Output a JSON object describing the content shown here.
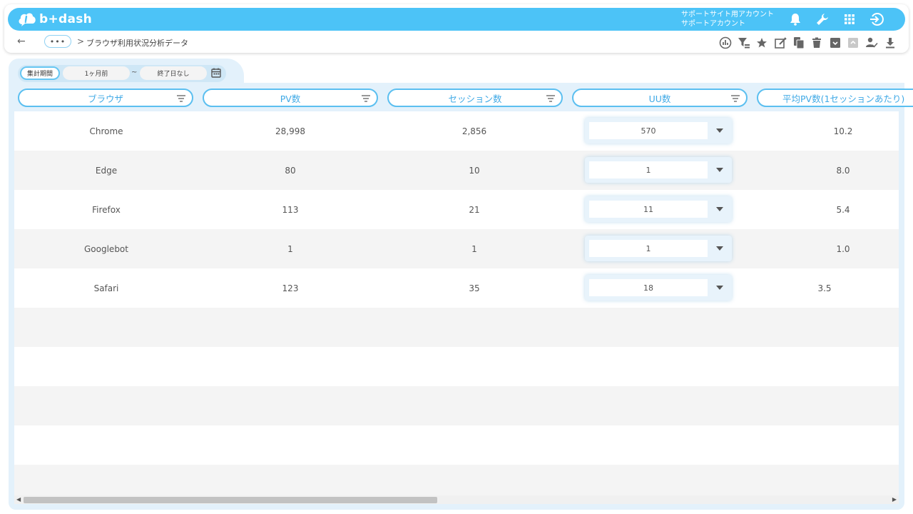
{
  "header": {
    "logo": "b+dash",
    "account_line1": "サポートサイト用アカウント",
    "account_line2": "サポートアカウント",
    "icons": [
      "bell-icon",
      "wrench-icon",
      "apps-grid-icon",
      "logout-icon"
    ]
  },
  "breadcrumb": {
    "back": "←",
    "more": "•••",
    "separator": ">",
    "title": "ブラウザ利用状況分析データ"
  },
  "toolbar": {
    "icons": [
      "chart-icon",
      "filter-icon",
      "star-icon",
      "edit-icon",
      "copy-icon",
      "trash-icon",
      "archive-icon",
      "unarchive-icon",
      "approve-icon",
      "download-icon"
    ]
  },
  "period": {
    "label": "集計期間",
    "start": "1ヶ月前",
    "tilde": "~",
    "end": "終了日なし"
  },
  "table": {
    "columns": [
      "ブラウザ",
      "PV数",
      "セッション数",
      "UU数",
      "平均PV数(1セッションあたり)"
    ],
    "rows": [
      {
        "browser": "Chrome",
        "pv": "28,998",
        "sessions": "2,856",
        "uu": "570",
        "avg_pv": "10.2"
      },
      {
        "browser": "Edge",
        "pv": "80",
        "sessions": "10",
        "uu": "1",
        "avg_pv": "8.0"
      },
      {
        "browser": "Firefox",
        "pv": "113",
        "sessions": "21",
        "uu": "11",
        "avg_pv": "5.4"
      },
      {
        "browser": "Googlebot",
        "pv": "1",
        "sessions": "1",
        "uu": "1",
        "avg_pv": "1.0"
      },
      {
        "browser": "Safari",
        "pv": "123",
        "sessions": "35",
        "uu": "18",
        "avg_pv": "3.5"
      }
    ]
  },
  "colors": {
    "brand": "#4cc3f7",
    "header_border": "#5bbff0",
    "header_text": "#3fa9e6",
    "panel_bg": "#e3f1fb"
  }
}
